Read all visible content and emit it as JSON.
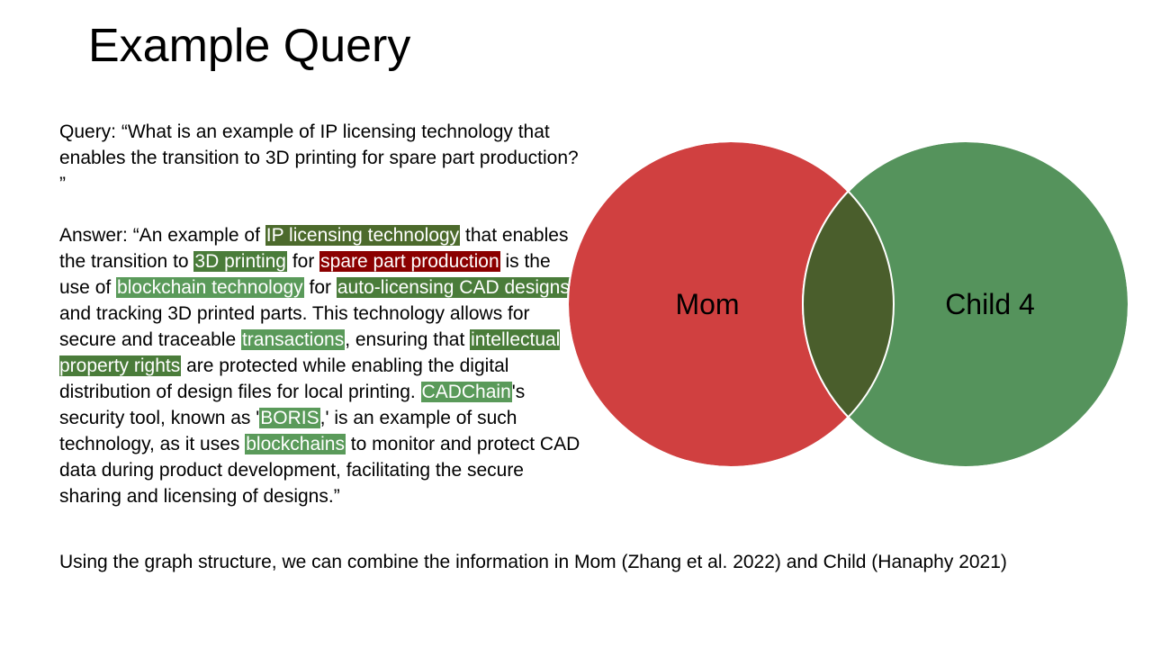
{
  "slide": {
    "title": "Example Query"
  },
  "query": {
    "text": "Query: “What is an example of IP licensing technology that enables the transition to 3D printing for spare part production? ”"
  },
  "answer": {
    "segments": [
      {
        "text": "Answer: “An example of ",
        "hl": null
      },
      {
        "text": "IP licensing technology",
        "hl": "dark"
      },
      {
        "text": " that enables the transition to ",
        "hl": null
      },
      {
        "text": "3D printing",
        "hl": "mid"
      },
      {
        "text": " for ",
        "hl": null
      },
      {
        "text": "spare part production",
        "hl": "red"
      },
      {
        "text": " is the use of ",
        "hl": null
      },
      {
        "text": "blockchain technology",
        "hl": "light"
      },
      {
        "text": " for ",
        "hl": null
      },
      {
        "text": "auto-licensing CAD designs",
        "hl": "mid"
      },
      {
        "text": " and tracking 3D printed parts. This technology allows for secure and traceable ",
        "hl": null
      },
      {
        "text": "transactions",
        "hl": "light"
      },
      {
        "text": ", ensuring that ",
        "hl": null
      },
      {
        "text": "intellectual property rights",
        "hl": "mid"
      },
      {
        "text": " are protected while enabling the digital distribution of design files for local printing. ",
        "hl": null
      },
      {
        "text": "CADChain",
        "hl": "light"
      },
      {
        "text": "'s security tool, known as '",
        "hl": null
      },
      {
        "text": "BORIS",
        "hl": "light"
      },
      {
        "text": ",' is an example of such technology, as it uses ",
        "hl": null
      },
      {
        "text": "blockchains",
        "hl": "light"
      },
      {
        "text": " to monitor and protect CAD data during product development, facilitating the secure sharing and licensing of designs.”",
        "hl": null
      }
    ]
  },
  "venn": {
    "left_label": "Mom",
    "right_label": "Child 4",
    "colors": {
      "left": "#d04040",
      "right": "#55935c",
      "overlap": "#4a5e2c"
    }
  },
  "footer": {
    "text": "Using the graph structure, we can combine the information in Mom (Zhang et al. 2022) and Child (Hanaphy 2021)"
  }
}
